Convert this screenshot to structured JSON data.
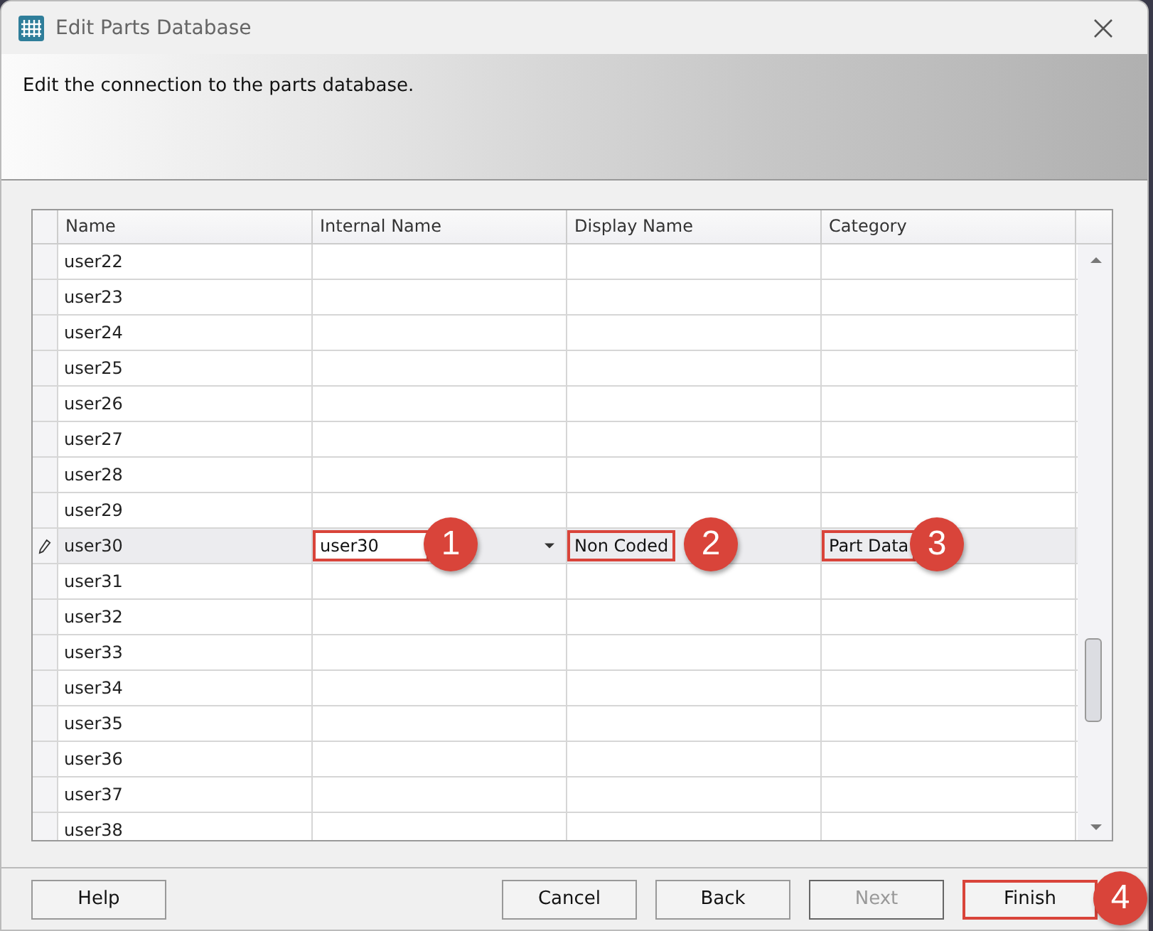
{
  "window": {
    "title": "Edit Parts Database"
  },
  "banner": {
    "text": "Edit the connection to the parts database."
  },
  "table": {
    "columns": [
      "Name",
      "Internal Name",
      "Display Name",
      "Category"
    ],
    "rows": [
      {
        "name": "user22",
        "editing": false
      },
      {
        "name": "user23",
        "editing": false
      },
      {
        "name": "user24",
        "editing": false
      },
      {
        "name": "user25",
        "editing": false
      },
      {
        "name": "user26",
        "editing": false
      },
      {
        "name": "user27",
        "editing": false
      },
      {
        "name": "user28",
        "editing": false
      },
      {
        "name": "user29",
        "editing": false
      },
      {
        "name": "user30",
        "editing": true,
        "cells": [
          {
            "value": "user30",
            "kind": "dropdown",
            "callout": "1"
          },
          {
            "value": "Non Coded",
            "kind": "text",
            "callout": "2"
          },
          {
            "value": "Part Data",
            "kind": "text",
            "callout": "3"
          }
        ]
      },
      {
        "name": "user31",
        "editing": false
      },
      {
        "name": "user32",
        "editing": false
      },
      {
        "name": "user33",
        "editing": false
      },
      {
        "name": "user34",
        "editing": false
      },
      {
        "name": "user35",
        "editing": false
      },
      {
        "name": "user36",
        "editing": false
      },
      {
        "name": "user37",
        "editing": false
      },
      {
        "name": "user38",
        "editing": false
      }
    ]
  },
  "buttons": [
    {
      "label": "Help",
      "disabled": false
    },
    {
      "label": "Cancel",
      "disabled": false
    },
    {
      "label": "Back",
      "disabled": false
    },
    {
      "label": "Next",
      "disabled": true
    },
    {
      "label": "Finish",
      "disabled": false,
      "callout": "4"
    }
  ]
}
